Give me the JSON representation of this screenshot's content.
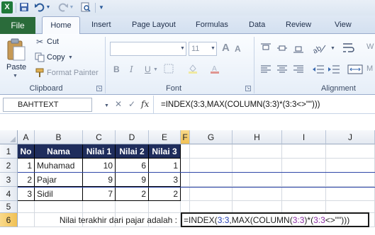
{
  "qat": {
    "logo": "X",
    "icons": [
      "save-icon",
      "undo-icon",
      "redo-icon",
      "print-preview-icon",
      "customize-icon"
    ]
  },
  "tabs": [
    {
      "label": "File"
    },
    {
      "label": "Home"
    },
    {
      "label": "Insert"
    },
    {
      "label": "Page Layout"
    },
    {
      "label": "Formulas"
    },
    {
      "label": "Data"
    },
    {
      "label": "Review"
    },
    {
      "label": "View"
    }
  ],
  "ribbon": {
    "clipboard": {
      "paste": "Paste",
      "cut": "Cut",
      "copy": "Copy",
      "format_painter": "Format Painter",
      "group_label": "Clipboard"
    },
    "font": {
      "font_size": "11",
      "bold": "B",
      "italic": "I",
      "underline": "U",
      "grow": "A",
      "shrink": "A",
      "group_label": "Font"
    },
    "alignment": {
      "group_label": "Alignment",
      "wrap_partial": "W",
      "merge_partial": "M"
    }
  },
  "formula_bar": {
    "name_box": "BAHTTEXT",
    "fx": "fx",
    "formula": "=INDEX(3:3,MAX(COLUMN(3:3)*(3:3<>\"\")))"
  },
  "sheet": {
    "columns": [
      "A",
      "B",
      "C",
      "D",
      "E",
      "F",
      "G",
      "H",
      "I",
      "J"
    ],
    "selected_column": "F",
    "selected_row": "6",
    "rows": [
      "1",
      "2",
      "3",
      "4",
      "5",
      "6"
    ],
    "header_row": [
      "No",
      "Nama",
      "Nilai 1",
      "Nilai 2",
      "Nilai 3"
    ],
    "data": [
      [
        "1",
        "Muhamad",
        "10",
        "6",
        "1"
      ],
      [
        "2",
        "Pajar",
        "9",
        "9",
        "3"
      ],
      [
        "3",
        "Sidil",
        "7",
        "2",
        "2"
      ]
    ],
    "label_row6": "Nilai terakhir dari pajar adalah :",
    "edit_formula_parts": [
      {
        "text": "=INDEX(",
        "cls": ""
      },
      {
        "text": "3:3",
        "cls": "ref-a"
      },
      {
        "text": ",MAX(COLUMN(",
        "cls": ""
      },
      {
        "text": "3:3",
        "cls": "ref-b"
      },
      {
        "text": ")*(",
        "cls": ""
      },
      {
        "text": "3:3",
        "cls": "ref-b"
      },
      {
        "text": "<>\"\")))",
        "cls": ""
      }
    ]
  }
}
